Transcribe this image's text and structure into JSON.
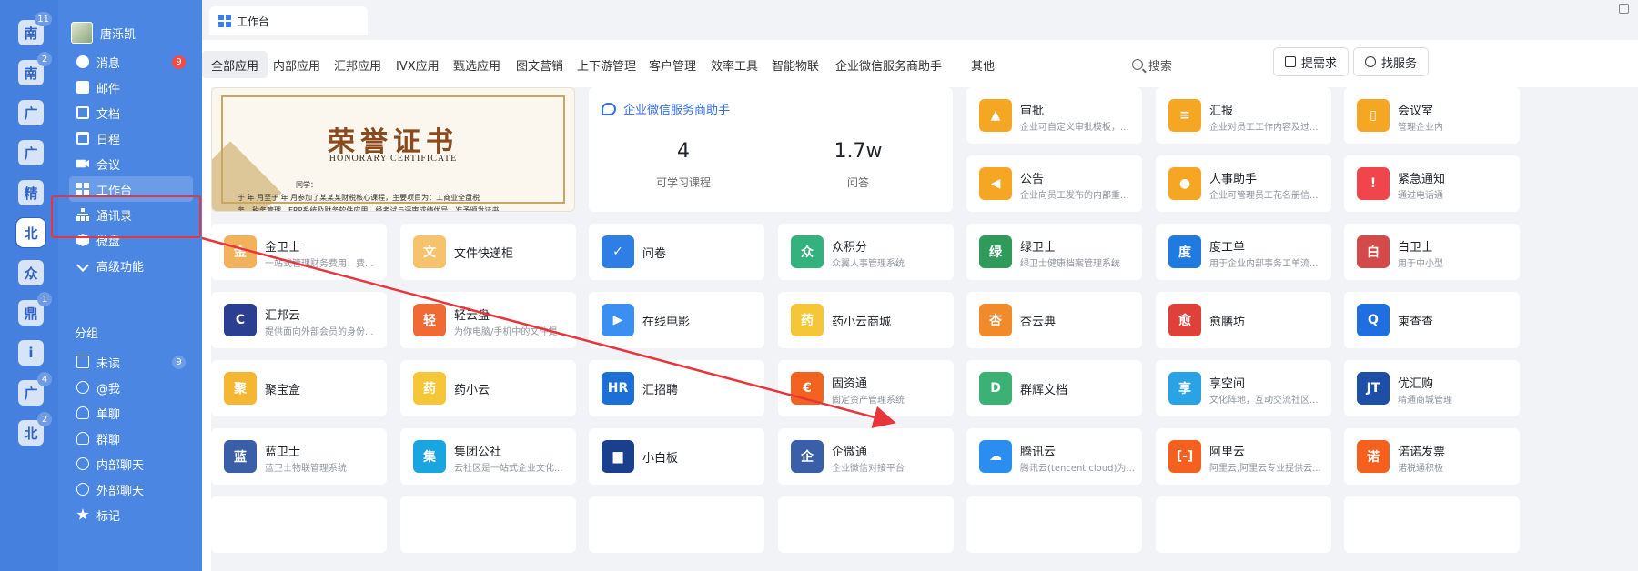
{
  "rail": {
    "workspaces": [
      {
        "label": "南",
        "badge": "11"
      },
      {
        "label": "南",
        "badge": "2"
      },
      {
        "label": "广",
        "badge": ""
      },
      {
        "label": "广",
        "badge": ""
      },
      {
        "label": "精",
        "badge": ""
      },
      {
        "label": "北",
        "badge": "",
        "active": true
      },
      {
        "label": "众",
        "badge": ""
      },
      {
        "label": "鼎",
        "badge": "1"
      },
      {
        "label": "i",
        "badge": ""
      },
      {
        "label": "广",
        "badge": "4"
      },
      {
        "label": "北",
        "badge": "2"
      }
    ]
  },
  "sidebar": {
    "user_name": "唐泺凯",
    "items": [
      {
        "label": "消息",
        "badge": "9",
        "icon": "message-icon"
      },
      {
        "label": "邮件",
        "badge": "",
        "icon": "mail-icon"
      },
      {
        "label": "文档",
        "badge": "",
        "icon": "doc-icon"
      },
      {
        "label": "日程",
        "badge": "",
        "icon": "calendar-icon"
      },
      {
        "label": "会议",
        "badge": "",
        "icon": "meeting-icon"
      },
      {
        "label": "工作台",
        "badge": "",
        "icon": "workbench-icon",
        "active": true
      },
      {
        "label": "通讯录",
        "badge": "",
        "icon": "contacts-icon"
      },
      {
        "label": "微盘",
        "badge": "",
        "icon": "disk-icon"
      },
      {
        "label": "高级功能",
        "badge": "",
        "icon": "advanced-icon"
      }
    ],
    "group_title": "分组",
    "group_items": [
      {
        "label": "未读",
        "badge": "9",
        "icon": "unread-icon"
      },
      {
        "label": "@我",
        "badge": "",
        "icon": "mention-icon"
      },
      {
        "label": "单聊",
        "badge": "",
        "icon": "single-chat-icon"
      },
      {
        "label": "群聊",
        "badge": "",
        "icon": "group-chat-icon"
      },
      {
        "label": "内部聊天",
        "badge": "",
        "icon": "internal-chat-icon"
      },
      {
        "label": "外部聊天",
        "badge": "",
        "icon": "external-chat-icon"
      },
      {
        "label": "标记",
        "badge": "",
        "icon": "star-icon"
      }
    ]
  },
  "window": {
    "tab_title": "工作台"
  },
  "categories": [
    "全部应用",
    "内部应用",
    "汇邦应用",
    "IVX应用",
    "甄选应用",
    "图文营销",
    "上下游管理",
    "客户管理",
    "效率工具",
    "智能物联",
    "企业微信服务商助手",
    "其他"
  ],
  "search_label": "搜索",
  "buttons": {
    "request": "提需求",
    "service": "找服务"
  },
  "banner": {
    "title": "荣誉证书",
    "subtitle": "HONORARY CERTIFICATE",
    "text_line1": "同学：",
    "text_line2": "于      年    月至于      年    月参加了某某某财税核心课程，主要项目为：工商业全盘税",
    "text_line3": "务、税务管理、ERP系统及财务软件应用，经考试与评审成绩优异，准予颁发证书。"
  },
  "helper": {
    "title": "企业微信服务商助手",
    "courses_value": "4",
    "courses_label": "可学习课程",
    "qa_value": "1.7w",
    "qa_label": "问答"
  },
  "top_right_cards": [
    {
      "name": "审批",
      "desc": "企业可自定义审批模板，...",
      "color": "#f5a623",
      "glyph": "▲"
    },
    {
      "name": "汇报",
      "desc": "企业对员工工作内容及过...",
      "color": "#f5a623",
      "glyph": "≡"
    },
    {
      "name": "会议室",
      "desc": "管理企业内",
      "color": "#f5a623",
      "glyph": "▯"
    },
    {
      "name": "公告",
      "desc": "企业向员工发布的内部重...",
      "color": "#f5a623",
      "glyph": "◀"
    },
    {
      "name": "人事助手",
      "desc": "企业可管理员工花名册信...",
      "color": "#f5a623",
      "glyph": "●"
    },
    {
      "name": "紧急通知",
      "desc": "通过电话通",
      "color": "#f0454b",
      "glyph": "!"
    }
  ],
  "app_cards": [
    {
      "name": "金卫士",
      "desc": "一站式管理财务费用、费...",
      "color": "#f2b25c",
      "glyph": "金"
    },
    {
      "name": "文件快递柜",
      "desc": "",
      "color": "#f6c26b",
      "glyph": "文"
    },
    {
      "name": "问卷",
      "desc": "",
      "color": "#2f7ee6",
      "glyph": "✓"
    },
    {
      "name": "众积分",
      "desc": "众翼人事管理系统",
      "color": "#34b27d",
      "glyph": "众"
    },
    {
      "name": "绿卫士",
      "desc": "绿卫士健康档案管理系统",
      "color": "#2e9b5a",
      "glyph": "绿"
    },
    {
      "name": "度工单",
      "desc": "用于企业内部事务工单流...",
      "color": "#1f7be0",
      "glyph": "度"
    },
    {
      "name": "白卫士",
      "desc": "用于中小型",
      "color": "#d44a4a",
      "glyph": "白"
    },
    {
      "name": "汇邦云",
      "desc": "提供面向外部会员的身份...",
      "color": "#2a3f8f",
      "glyph": "C"
    },
    {
      "name": "轻云盘",
      "desc": "为你电脑/手机中的文件提...",
      "color": "#f06a35",
      "glyph": "轻"
    },
    {
      "name": "在线电影",
      "desc": "",
      "color": "#3a8ff0",
      "glyph": "▶"
    },
    {
      "name": "药小云商城",
      "desc": "",
      "color": "#f5c637",
      "glyph": "药"
    },
    {
      "name": "杏云典",
      "desc": "",
      "color": "#f08a2a",
      "glyph": "杏"
    },
    {
      "name": "愈膳坊",
      "desc": "",
      "color": "#e0403a",
      "glyph": "愈"
    },
    {
      "name": "柬查查",
      "desc": "",
      "color": "#1f6fe0",
      "glyph": "Q"
    },
    {
      "name": "聚宝盒",
      "desc": "",
      "color": "#f5b631",
      "glyph": "聚"
    },
    {
      "name": "药小云",
      "desc": "",
      "color": "#f5c637",
      "glyph": "药"
    },
    {
      "name": "汇招聘",
      "desc": "",
      "color": "#1b6fd6",
      "glyph": "HR"
    },
    {
      "name": "固资通",
      "desc": "固定资产管理系统",
      "color": "#f3621f",
      "glyph": "€"
    },
    {
      "name": "群辉文档",
      "desc": "",
      "color": "#3bb273",
      "glyph": "D"
    },
    {
      "name": "享空间",
      "desc": "文化阵地，互动交流社区...",
      "color": "#2aa3e6",
      "glyph": "享"
    },
    {
      "name": "优汇购",
      "desc": "精通商城管理",
      "color": "#1e4fa8",
      "glyph": "JT"
    },
    {
      "name": "蓝卫士",
      "desc": "蓝卫士物联管理系统",
      "color": "#3a5ea8",
      "glyph": "蓝"
    },
    {
      "name": "集团公社",
      "desc": "云社区是一站式企业文化...",
      "color": "#19a6e0",
      "glyph": "集"
    },
    {
      "name": "小白板",
      "desc": "",
      "color": "#1b3f8f",
      "glyph": "▆"
    },
    {
      "name": "企微通",
      "desc": "企业微信对接平台",
      "color": "#3a5ea8",
      "glyph": "企"
    },
    {
      "name": "腾讯云",
      "desc": "腾讯云(tencent cloud)为...",
      "color": "#2a8ef0",
      "glyph": "☁"
    },
    {
      "name": "阿里云",
      "desc": "阿里云,阿里云专业提供云...",
      "color": "#f5601f",
      "glyph": "[-]"
    },
    {
      "name": "诺诺发票",
      "desc": "诺税通积极",
      "color": "#f5601f",
      "glyph": "诺"
    }
  ]
}
